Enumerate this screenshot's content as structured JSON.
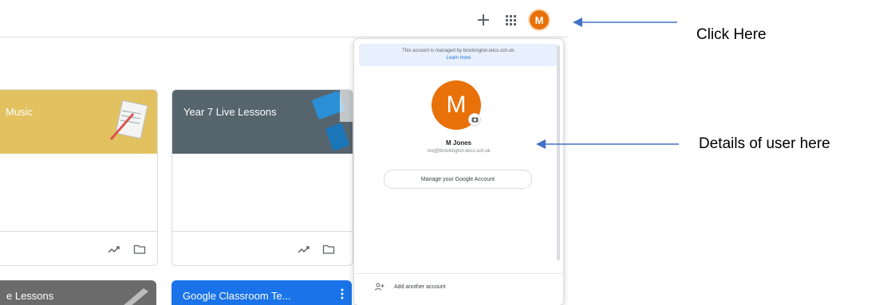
{
  "header": {
    "add_icon": "plus-icon",
    "apps_icon": "apps-grid-icon",
    "avatar_initial": "M"
  },
  "cards": [
    {
      "title": "Music",
      "banner_color": "#e2c160"
    },
    {
      "title": "Year 7 Live Lessons",
      "banner_color": "#56646e"
    }
  ],
  "bottom_cards": [
    {
      "title": "e Lessons",
      "banner_color": "#6b6b6b"
    },
    {
      "title": "Google Classroom Te...",
      "banner_color": "#1a73e8"
    }
  ],
  "account_popup": {
    "managed_notice": "This account is managed by brockington.leics.sch.uk.",
    "learn_more": "Learn more",
    "avatar_initial": "M",
    "name": "M Jones",
    "email": "mxj@brockington.leics.sch.uk",
    "manage_button": "Manage your Google Account",
    "add_account": "Add another account"
  },
  "annotations": {
    "click_here": "Click Here",
    "details": "Details of user here",
    "arrow_color": "#4472c4"
  }
}
